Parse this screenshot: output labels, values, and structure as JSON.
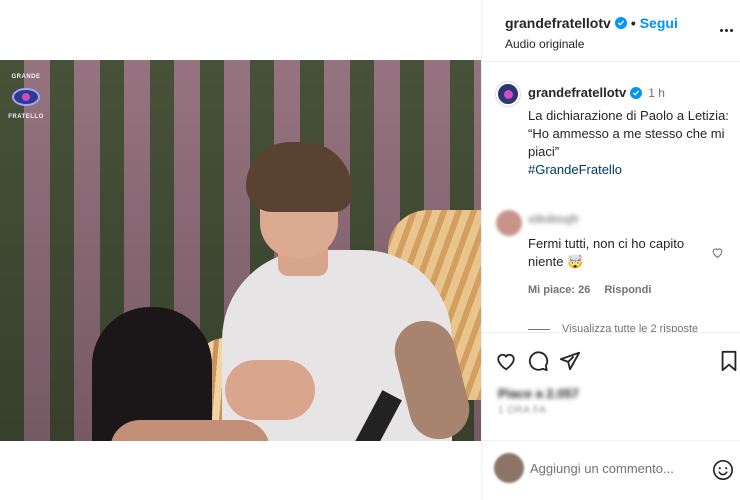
{
  "media": {
    "logo": {
      "top": "GRANDE",
      "bottom": "FRATELLO"
    },
    "mute_icon": "speaker-muted-icon"
  },
  "header": {
    "username": "grandefratellotv",
    "verified_icon": "verified-badge-icon",
    "separator": "•",
    "follow_label": "Segui",
    "subtitle": "Audio originale",
    "more_icon": "more-options-icon"
  },
  "caption": {
    "username": "grandefratellotv",
    "time": "1 h",
    "text": "La dichiarazione di Paolo a Letizia: “Ho ammesso a me stesso che mi piaci”",
    "hashtag": "#GrandeFratello"
  },
  "comment": {
    "username": "stkdmqfr",
    "text": "Fermi tutti, non ci ho capito niente 🤯",
    "likes_label": "Mi piace: 26",
    "reply_label": "Rispondi",
    "view_replies": "Visualizza tutte le 2 risposte"
  },
  "actions": {
    "like_icon": "heart-icon",
    "comment_icon": "comment-icon",
    "share_icon": "share-icon",
    "save_icon": "bookmark-icon"
  },
  "stats": {
    "likes": "Piace a 2.057",
    "date": "1 ORA FA"
  },
  "composer": {
    "placeholder": "Aggiungi un commento...",
    "emoji_icon": "emoji-icon"
  },
  "colors": {
    "accent": "#0095f6",
    "text": "#262626",
    "muted": "#737373",
    "hashtag": "#00376b"
  }
}
